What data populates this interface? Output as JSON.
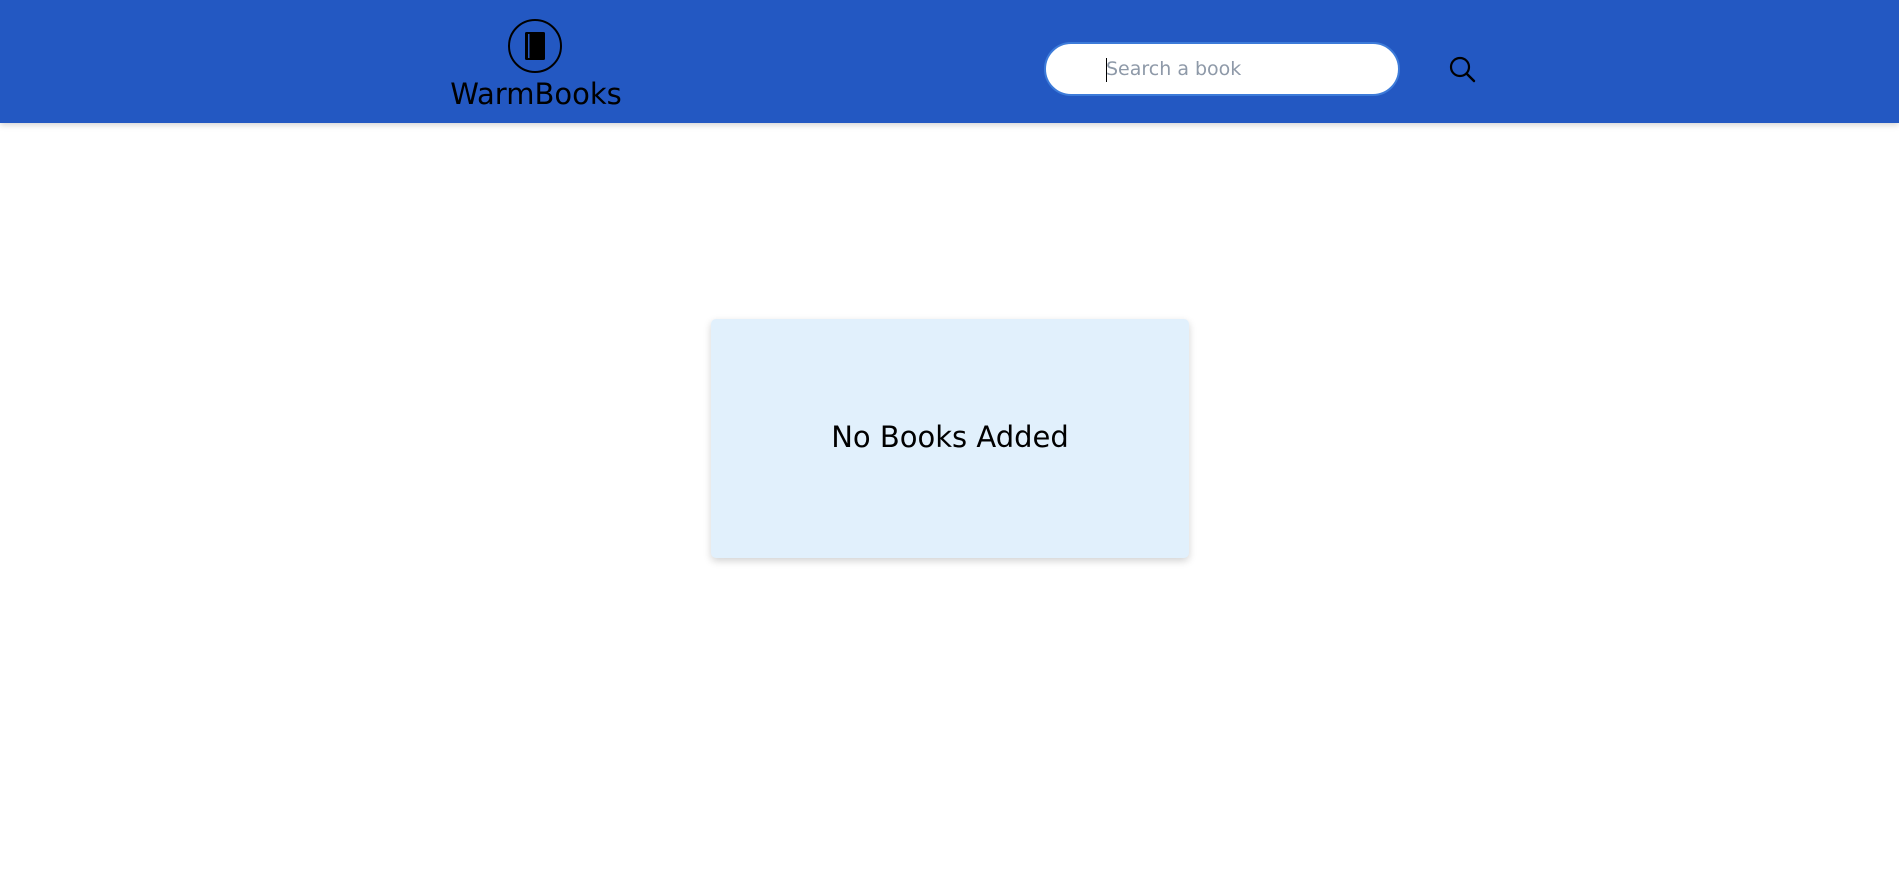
{
  "header": {
    "background_color": "#2358c2",
    "brand": {
      "name": "WarmBooks",
      "icon": "book-icon"
    }
  },
  "search": {
    "value": "",
    "placeholder": "Search a book",
    "button_icon": "search-icon",
    "border_color": "#3d7bd9"
  },
  "main": {
    "empty_message": "No Books Added",
    "card_color": "#e1f0fc"
  }
}
